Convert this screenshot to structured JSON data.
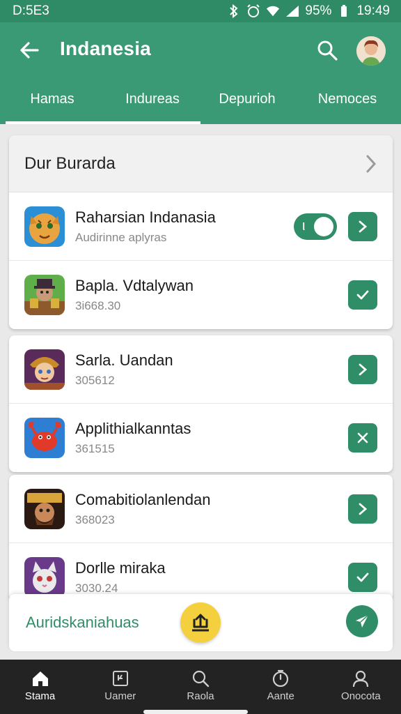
{
  "status_bar": {
    "left_text": "D:5E3",
    "battery": "95%",
    "time": "19:49"
  },
  "app_bar": {
    "title": "Indanesia"
  },
  "tabs": [
    {
      "label": "Hamas",
      "active": true
    },
    {
      "label": "Indureas",
      "active": false
    },
    {
      "label": "Depurioh",
      "active": false
    },
    {
      "label": "Nemoces",
      "active": false
    }
  ],
  "section": {
    "title": "Dur Burarda"
  },
  "group1": [
    {
      "title": "Raharsian Indanasia",
      "subtitle": "Audirinne aplyras",
      "toggle": true,
      "action": "chevron"
    },
    {
      "title": "Bapla. Vdtalywan",
      "subtitle": "3i668.30",
      "action": "check"
    }
  ],
  "group2": [
    {
      "title": "Sarla. Uandan",
      "subtitle": "305612",
      "action": "chevron"
    },
    {
      "title": "Applithialkanntas",
      "subtitle": "361515",
      "action": "close"
    }
  ],
  "group3": [
    {
      "title": "Comabitiolanlendan",
      "subtitle": "368023",
      "action": "chevron"
    },
    {
      "title": "Dorlle miraka",
      "subtitle": "3030.24",
      "action": "check"
    }
  ],
  "action_bar": {
    "label": "Auridskaniahuas"
  },
  "bottom_nav": [
    {
      "label": "Stama",
      "icon": "home-icon",
      "active": true
    },
    {
      "label": "Uamer",
      "icon": "document-icon",
      "active": false
    },
    {
      "label": "Raola",
      "icon": "search-icon",
      "active": false
    },
    {
      "label": "Aante",
      "icon": "timer-icon",
      "active": false
    },
    {
      "label": "Onocota",
      "icon": "profile-icon",
      "active": false
    }
  ],
  "colors": {
    "primary": "#3a9a76",
    "accent": "#2f8e68",
    "fab": "#f4d03f"
  }
}
